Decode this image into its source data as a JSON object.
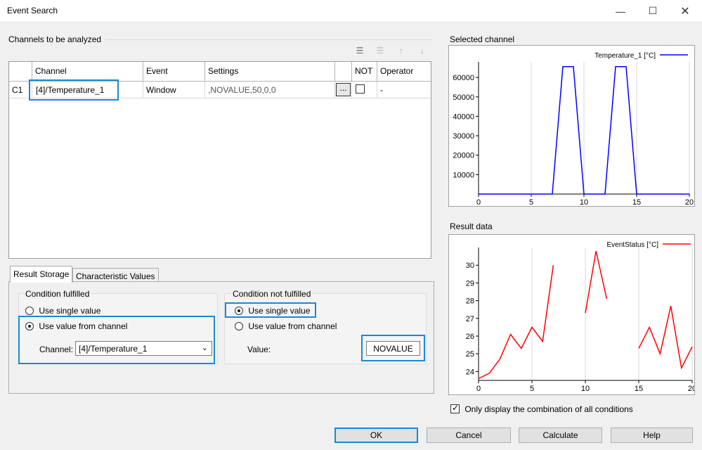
{
  "window": {
    "title": "Event Search"
  },
  "channels_section": {
    "caption": "Channels to be analyzed",
    "columns": [
      "Channel",
      "Event",
      "Settings",
      "",
      "NOT",
      "Operator"
    ],
    "rows": [
      {
        "id": "C1",
        "channel": "[4]/Temperature_1",
        "event": "Window",
        "settings": ",NOVALUE,50,0,0",
        "browse": "...",
        "not_checked": false,
        "operator": "-"
      }
    ]
  },
  "tabs": [
    {
      "label": "Result Storage",
      "active": true
    },
    {
      "label": "Characteristic Values",
      "active": false
    }
  ],
  "condition_fulfilled": {
    "caption": "Condition fulfilled",
    "option_single_value": "Use single value",
    "option_from_channel": "Use value from channel",
    "selected": "from_channel",
    "channel_label": "Channel:",
    "channel_value": "[4]/Temperature_1"
  },
  "condition_not_fulfilled": {
    "caption": "Condition not fulfilled",
    "option_single_value": "Use single value",
    "option_from_channel": "Use value from channel",
    "selected": "single_value",
    "value_label": "Value:",
    "value": "NOVALUE"
  },
  "selected_channel": {
    "caption": "Selected channel"
  },
  "result_data": {
    "caption": "Result data"
  },
  "only_combination": {
    "label": "Only display the combination of all conditions",
    "checked": true
  },
  "buttons": {
    "ok": "OK",
    "cancel": "Cancel",
    "calculate": "Calculate",
    "help": "Help"
  },
  "colors": {
    "selected_series": "#0000ff",
    "result_series": "#ff0000",
    "focus_highlight": "#1a8ad4"
  },
  "chart_data": [
    {
      "type": "line",
      "legend": "top-right",
      "grid": true,
      "xlim": [
        0,
        20
      ],
      "ylim": [
        0,
        68000
      ],
      "xticks": [
        0,
        5,
        10,
        15,
        20
      ],
      "yticks": [
        10000,
        20000,
        30000,
        40000,
        50000,
        60000
      ],
      "series": [
        {
          "name": "Temperature_1 [°C]",
          "color": "#0000ff",
          "x": [
            0,
            7,
            8,
            9,
            10,
            12,
            13,
            14,
            15,
            20
          ],
          "y": [
            0,
            0,
            65535,
            65535,
            0,
            0,
            65535,
            65535,
            0,
            0
          ]
        }
      ]
    },
    {
      "type": "line",
      "legend": "top-right",
      "grid": true,
      "xlim": [
        0,
        20
      ],
      "ylim": [
        23.5,
        31
      ],
      "xticks": [
        0,
        5,
        10,
        15,
        20
      ],
      "yticks": [
        24,
        25,
        26,
        27,
        28,
        29,
        30
      ],
      "series": [
        {
          "name": "EventStatus [°C]",
          "color": "#ff0000",
          "x": [
            0,
            1,
            2,
            3,
            4,
            5,
            6,
            7,
            null,
            10,
            11,
            12,
            null,
            15,
            16,
            17,
            18,
            19,
            20
          ],
          "y": [
            23.6,
            23.9,
            24.7,
            26.1,
            25.3,
            26.5,
            25.7,
            30.0,
            null,
            27.3,
            30.8,
            28.1,
            null,
            25.3,
            26.5,
            25.0,
            27.7,
            24.2,
            25.4
          ]
        }
      ]
    }
  ]
}
